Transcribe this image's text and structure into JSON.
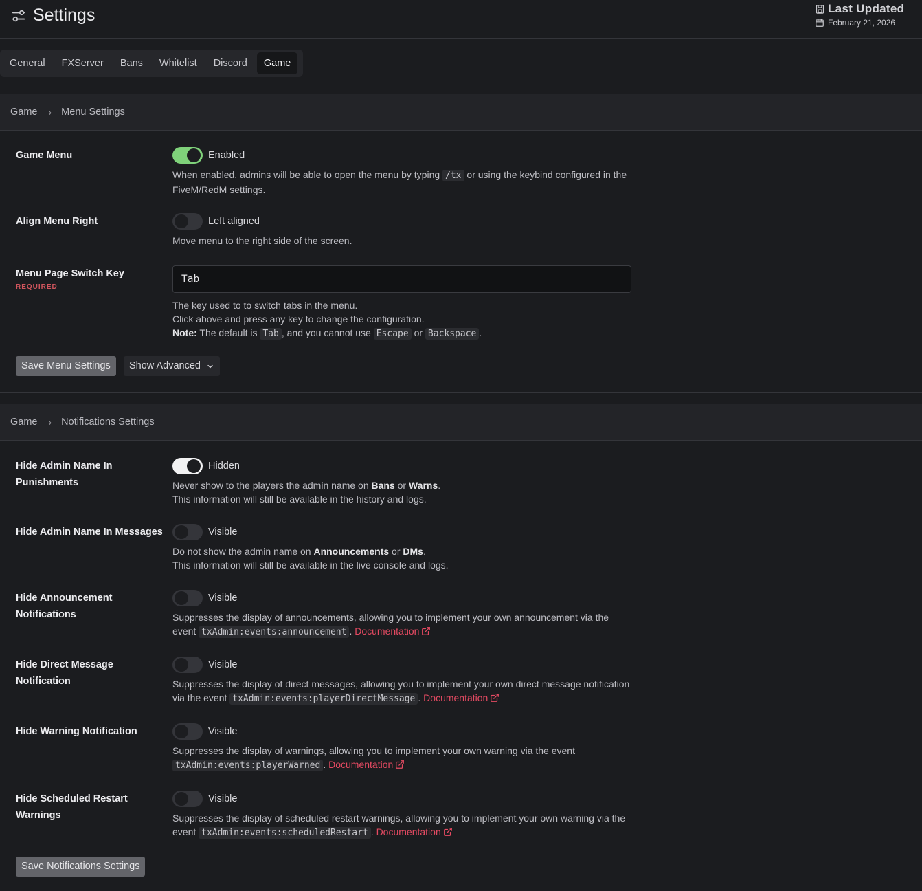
{
  "header": {
    "title": "Settings",
    "updated_title": "Last Updated",
    "updated_date": "February 21, 2026"
  },
  "tabs": [
    {
      "label": "General",
      "active": false
    },
    {
      "label": "FXServer",
      "active": false
    },
    {
      "label": "Bans",
      "active": false
    },
    {
      "label": "Whitelist",
      "active": false
    },
    {
      "label": "Discord",
      "active": false
    },
    {
      "label": "Game",
      "active": true
    }
  ],
  "menu_card": {
    "crumb_root": "Game",
    "crumb_page": "Menu Settings",
    "game_menu": {
      "label": "Game Menu",
      "state": "Enabled",
      "desc_a": "When enabled, admins will be able to open the menu by typing ",
      "code": "/tx",
      "desc_b": " or using the keybind configured in the FiveM/RedM settings."
    },
    "align_right": {
      "label": "Align Menu Right",
      "state": "Left aligned",
      "desc": "Move menu to the right side of the screen."
    },
    "switch_key": {
      "label": "Menu Page Switch Key",
      "required": "REQUIRED",
      "value": "Tab",
      "line1": "The key used to to switch tabs in the menu.",
      "line2": "Click above and press any key to change the configuration.",
      "note_label": "Note:",
      "note_a": " The default is ",
      "code_tab": "Tab",
      "note_b": ", and you cannot use ",
      "code_escape": "Escape",
      "note_c": " or ",
      "code_backspace": "Backspace",
      "note_d": "."
    },
    "save_label": "Save Menu Settings",
    "advanced_label": "Show Advanced"
  },
  "notif_card": {
    "crumb_root": "Game",
    "crumb_page": "Notifications Settings",
    "hide_admin_punish": {
      "label": "Hide Admin Name In Punishments",
      "state": "Hidden",
      "desc_a": "Never show to the players the admin name on ",
      "bold_1": "Bans",
      "desc_b": " or ",
      "bold_2": "Warns",
      "desc_c": ".",
      "line2": "This information will still be available in the history and logs."
    },
    "hide_admin_msg": {
      "label": "Hide Admin Name In Messages",
      "state": "Visible",
      "desc_a": "Do not show the admin name on ",
      "bold_1": "Announcements",
      "desc_b": " or ",
      "bold_2": "DMs",
      "desc_c": ".",
      "line2": "This information will still be available in the live console and logs."
    },
    "hide_announce": {
      "label": "Hide Announcement Notifications",
      "state": "Visible",
      "desc_a": "Suppresses the display of announcements, allowing you to implement your own announcement via the event ",
      "code": "txAdmin:events:announcement",
      "desc_b": ". ",
      "link": "Documentation"
    },
    "hide_dm": {
      "label": "Hide Direct Message Notification",
      "state": "Visible",
      "desc_a": "Suppresses the display of direct messages, allowing you to implement your own direct message notification via the event ",
      "code": "txAdmin:events:playerDirectMessage",
      "desc_b": ". ",
      "link": "Documentation"
    },
    "hide_warning": {
      "label": "Hide Warning Notification",
      "state": "Visible",
      "desc_a": "Suppresses the display of warnings, allowing you to implement your own warning via the event ",
      "code": "txAdmin:events:playerWarned",
      "desc_b": ". ",
      "link": "Documentation"
    },
    "hide_restart": {
      "label": "Hide Scheduled Restart Warnings",
      "state": "Visible",
      "desc_a": "Suppresses the display of scheduled restart warnings, allowing you to implement your own warning via the event ",
      "code": "txAdmin:events:scheduledRestart",
      "desc_b": ". ",
      "link": "Documentation"
    },
    "save_label": "Save Notifications Settings"
  },
  "colors": {
    "background": "#1b1c1f",
    "switch_on": "#7fd17a",
    "link": "#e54a62",
    "required": "#d0555d"
  }
}
